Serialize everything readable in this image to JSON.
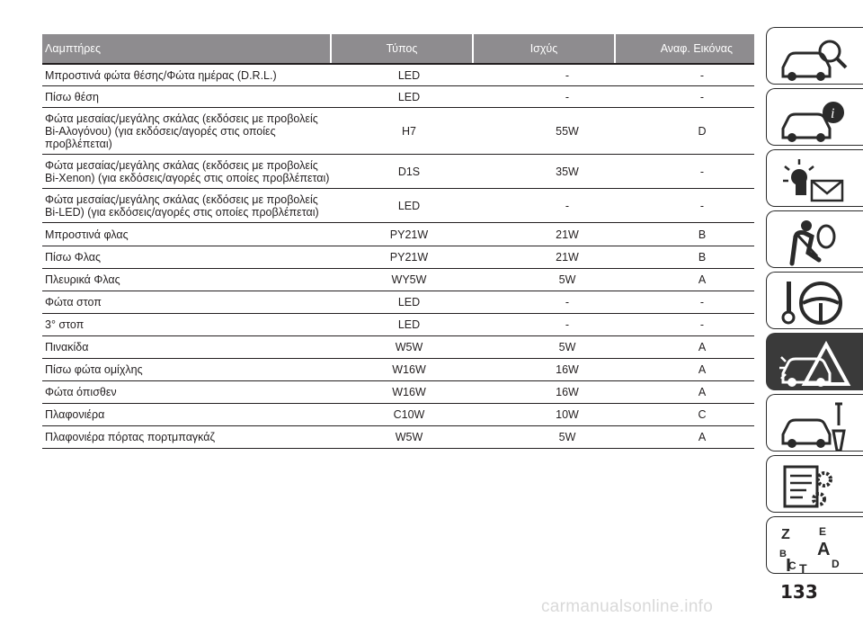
{
  "table": {
    "headers": [
      "Λαμπτήρες",
      "Τύπος",
      "Ισχύς",
      "Αναφ. Εικόνας"
    ],
    "rows": [
      {
        "lamp": "Μπροστινά φώτα θέσης/Φώτα ημέρας (D.R.L.)",
        "type": "LED",
        "power": "-",
        "ref": "-"
      },
      {
        "lamp": "Πίσω θέση",
        "type": "LED",
        "power": "-",
        "ref": "-"
      },
      {
        "lamp": "Φώτα μεσαίας/μεγάλης σκάλας (εκδόσεις με προβολείς Bi-Αλογόνου) (για εκδόσεις/αγορές στις οποίες προβλέπεται)",
        "type": "H7",
        "power": "55W",
        "ref": "D"
      },
      {
        "lamp": "Φώτα μεσαίας/μεγάλης σκάλας (εκδόσεις με προβολείς Bi-Xenon) (για εκδόσεις/αγορές στις οποίες προβλέπεται)",
        "type": "D1S",
        "power": "35W",
        "ref": "-"
      },
      {
        "lamp": "Φώτα μεσαίας/μεγάλης σκάλας (εκδόσεις με προβολείς Bi-LED) (για εκδόσεις/αγορές στις οποίες προβλέπεται)",
        "type": "LED",
        "power": "-",
        "ref": "-"
      },
      {
        "lamp": "Μπροστινά φλας",
        "type": "PY21W",
        "power": "21W",
        "ref": "B"
      },
      {
        "lamp": "Πίσω Φλας",
        "type": "PY21W",
        "power": "21W",
        "ref": "B"
      },
      {
        "lamp": "Πλευρικά Φλας",
        "type": "WY5W",
        "power": "5W",
        "ref": "A"
      },
      {
        "lamp": "Φώτα στοπ",
        "type": "LED",
        "power": "-",
        "ref": "-"
      },
      {
        "lamp": "3° στοπ",
        "type": "LED",
        "power": "-",
        "ref": "-"
      },
      {
        "lamp": "Πινακίδα",
        "type": "W5W",
        "power": "5W",
        "ref": "A"
      },
      {
        "lamp": "Πίσω φώτα ομίχλης",
        "type": "W16W",
        "power": "16W",
        "ref": "A"
      },
      {
        "lamp": "Φώτα όπισθεν",
        "type": "W16W",
        "power": "16W",
        "ref": "A"
      },
      {
        "lamp": "Πλαφονιέρα",
        "type": "C10W",
        "power": "10W",
        "ref": "C"
      },
      {
        "lamp": "Πλαφονιέρα πόρτας πορτμπαγκάζ",
        "type": "W5W",
        "power": "5W",
        "ref": "A"
      }
    ]
  },
  "side_tabs": [
    {
      "icon": "car-magnifier-icon",
      "active": false
    },
    {
      "icon": "car-info-icon",
      "active": false
    },
    {
      "icon": "warning-light-envelope-icon",
      "active": false
    },
    {
      "icon": "seatbelt-airbag-icon",
      "active": false
    },
    {
      "icon": "key-steering-wheel-icon",
      "active": false
    },
    {
      "icon": "car-warning-triangle-icon",
      "active": true
    },
    {
      "icon": "car-wrench-icon",
      "active": false
    },
    {
      "icon": "document-gears-icon",
      "active": false
    },
    {
      "icon": "alphabet-index-icon",
      "active": false
    }
  ],
  "page_number": "133",
  "watermark": "carmanualsonline.info"
}
